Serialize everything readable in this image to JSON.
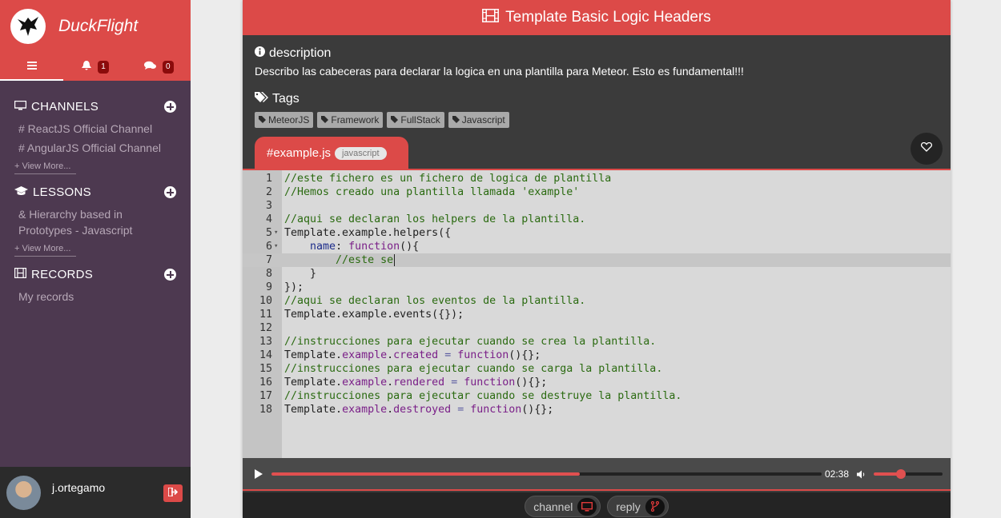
{
  "brand": {
    "name": "DuckFlight"
  },
  "topbar": {
    "notifications_count": "1",
    "messages_count": "0"
  },
  "sidebar": {
    "channels": {
      "title": "CHANNELS",
      "items": [
        "# ReactJS Official Channel",
        "# AngularJS Official Channel"
      ],
      "view_more": "+ View More..."
    },
    "lessons": {
      "title": "LESSONS",
      "items": [
        "& Hierarchy based in Prototypes - Javascript"
      ],
      "view_more": "+ View More..."
    },
    "records": {
      "title": "RECORDS",
      "items": [
        "My records"
      ]
    }
  },
  "user": {
    "name": "j.ortegamo"
  },
  "main": {
    "title": "Template Basic Logic Headers",
    "description_title": "description",
    "description": "Describo las cabeceras para declarar la logica en una plantilla para Meteor. Esto es fundamental!!!",
    "tags_title": "Tags",
    "tags": [
      "MeteorJS",
      "Framework",
      "FullStack",
      "Javascript"
    ],
    "file_tab": "#example.js",
    "language": "javascript"
  },
  "code_lines": [
    "//este fichero es un fichero de logica de plantilla",
    "//Hemos creado una plantilla llamada 'example'",
    "",
    "//aqui se declaran los helpers de la plantilla.",
    "Template.example.helpers({",
    "    name: function(){",
    "        //este se",
    "    }",
    "});",
    "//aqui se declaran los eventos de la plantilla.",
    "Template.example.events({});",
    "",
    "//instrucciones para ejecutar cuando se crea la plantilla.",
    "Template.example.created = function(){};",
    "//instrucciones para ejecutar cuando se carga la plantilla.",
    "Template.example.rendered = function(){};",
    "//instrucciones para ejecutar cuando se destruye la plantilla.",
    "Template.example.destroyed = function(){};"
  ],
  "player": {
    "time": "02:38",
    "progress": 0.56,
    "volume": 0.4
  },
  "bottom": {
    "channel_label": "channel",
    "reply_label": "reply"
  },
  "colors": {
    "accent": "#dc4a48",
    "sidebar": "#4d3950",
    "panel": "#3b3b3b"
  }
}
